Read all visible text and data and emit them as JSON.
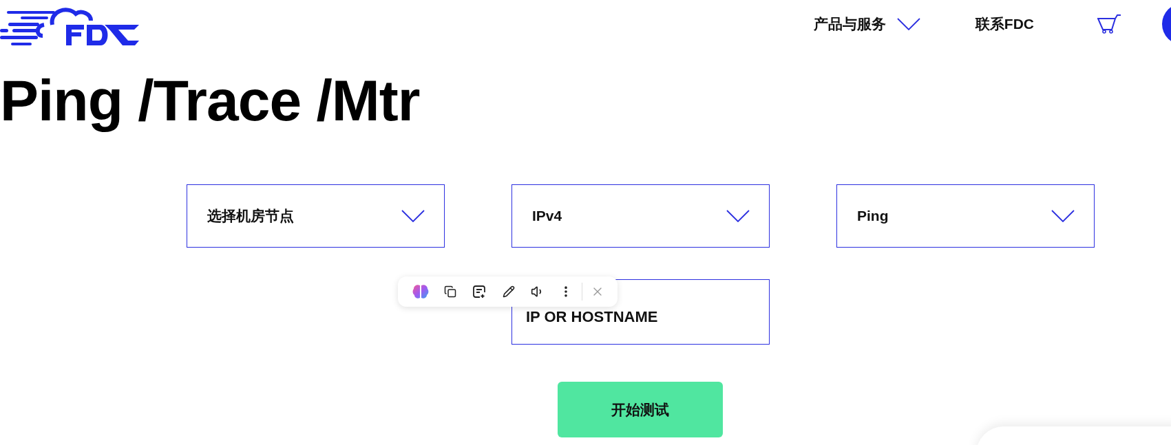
{
  "header": {
    "nav": [
      {
        "label": "产品与服务",
        "has_menu": true
      },
      {
        "label": "联系FDC",
        "has_menu": false
      }
    ]
  },
  "title": "Ping /Trace /Mtr",
  "selects": [
    {
      "value": "选择机房节点"
    },
    {
      "value": "IPv4"
    },
    {
      "value": "Ping"
    }
  ],
  "host_input": {
    "placeholder": "IP OR HOSTNAME"
  },
  "start_button": "开始测试"
}
